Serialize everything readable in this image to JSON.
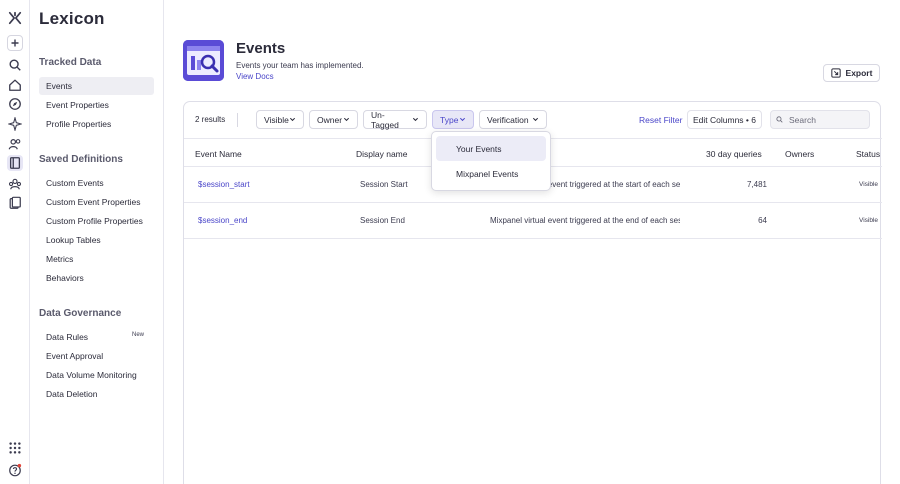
{
  "app": {
    "name": "Lexicon"
  },
  "rail": {
    "icons": [
      "logo-icon",
      "plus-icon",
      "search-icon",
      "home-icon",
      "discover-icon",
      "sparkle-icon",
      "users-icon",
      "lexicon-book-icon",
      "cohorts-icon",
      "docs-icon",
      "apps-grid-icon",
      "help-icon"
    ]
  },
  "sidebar": {
    "tracked_data": {
      "title": "Tracked Data",
      "items": [
        "Events",
        "Event Properties",
        "Profile Properties"
      ]
    },
    "saved_definitions": {
      "title": "Saved Definitions",
      "items": [
        "Custom Events",
        "Custom Event Properties",
        "Custom Profile Properties",
        "Lookup Tables",
        "Metrics",
        "Behaviors"
      ]
    },
    "data_governance": {
      "title": "Data Governance",
      "items": [
        "Data Rules",
        "Event Approval",
        "Data Volume Monitoring",
        "Data Deletion"
      ],
      "new_badge": "New"
    }
  },
  "header": {
    "title": "Events",
    "subtitle": "Events your team has implemented.",
    "docs_link": "View Docs",
    "export_label": "Export"
  },
  "toolbar": {
    "results": "2 results",
    "filters": [
      "Visible",
      "Owner",
      "Un-Tagged",
      "Type",
      "Verification"
    ],
    "reset_label": "Reset Filter",
    "edit_columns": "Edit Columns • 6",
    "search_placeholder": "Search"
  },
  "type_dropdown": {
    "options": [
      "Your Events",
      "Mixpanel Events"
    ],
    "selected": "Your Events"
  },
  "table": {
    "columns": [
      "Event Name",
      "Display name",
      "30 day queries",
      "Owners",
      "Status"
    ],
    "rows": [
      {
        "name": "$session_start",
        "display": "Session Start",
        "description": "Mixpanel virtual event triggered at the start of each session",
        "queries": "7,481",
        "owners": "",
        "status": "Visible"
      },
      {
        "name": "$session_end",
        "display": "Session End",
        "description": "Mixpanel virtual event triggered at the end of each session",
        "queries": "64",
        "owners": "",
        "status": "Visible"
      }
    ]
  },
  "colors": {
    "accent": "#4a46c9",
    "brand_purple": "#5a4bd6"
  }
}
